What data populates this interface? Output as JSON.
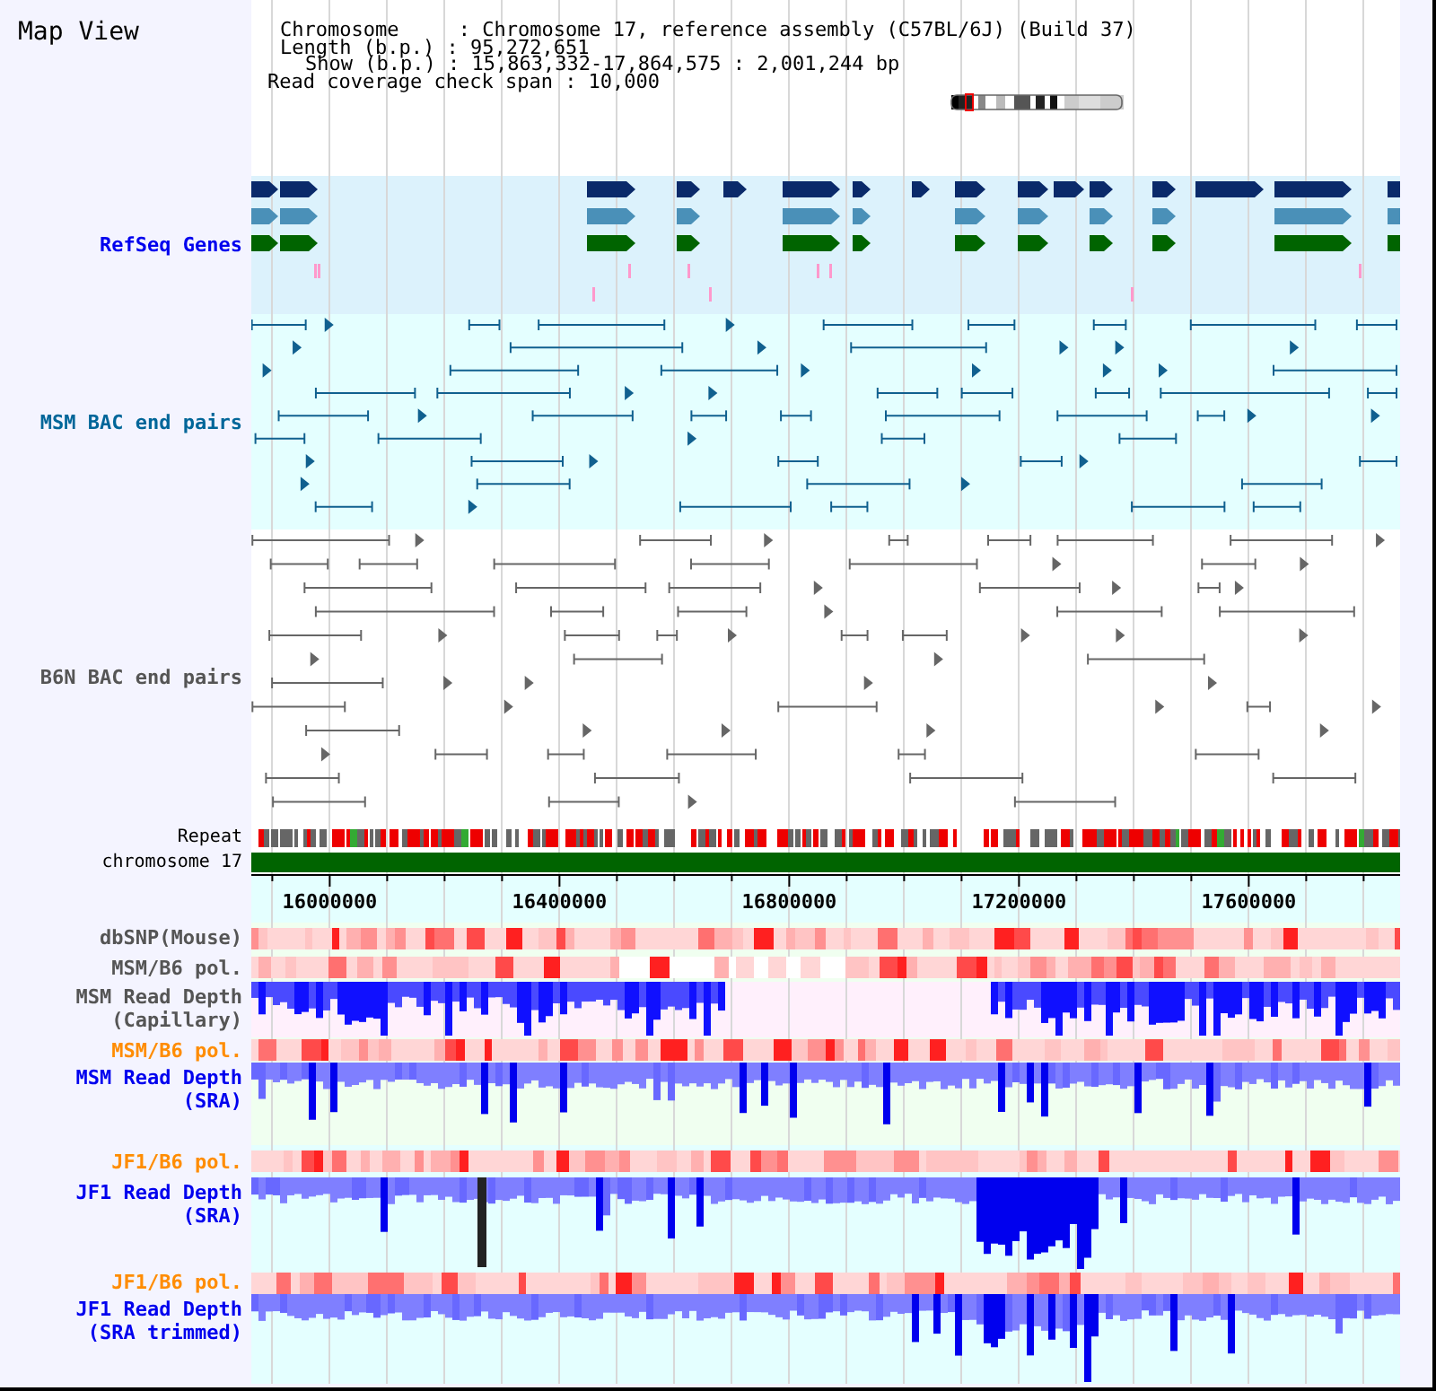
{
  "title": "Map View",
  "info_lines": [
    "Chromosome     : Chromosome 17, reference assembly (C57BL/6J) (Build 37)",
    "Length (b.p.) : 95,272,651",
    "Show (b.p.) : 15,863,332-17,864,575 : 2,001,244 bp",
    "Read coverage check span : 10,000"
  ],
  "tracks": [
    {
      "kind": "genes",
      "label": [
        "RefSeq Genes"
      ],
      "color": "#0000ee"
    },
    {
      "kind": "pairs",
      "label": [
        "MSM BAC end pairs"
      ],
      "color": "#006699"
    },
    {
      "kind": "pairs",
      "label": [
        "B6N BAC end pairs"
      ],
      "color": "#555555"
    },
    {
      "kind": "repeat",
      "label": [
        "Repeat"
      ],
      "color": "#000000"
    },
    {
      "kind": "chromosome",
      "label": [
        "chromosome 17"
      ],
      "color": "#000000"
    },
    {
      "kind": "axis",
      "ticks": [
        "16000000",
        "16400000",
        "16800000",
        "17200000",
        "17600000"
      ]
    },
    {
      "kind": "heat",
      "label": [
        "dbSNP(Mouse)"
      ],
      "color": "#555555"
    },
    {
      "kind": "heat",
      "label": [
        "MSM/B6 pol."
      ],
      "color": "#555555"
    },
    {
      "kind": "depth",
      "label": [
        "MSM Read Depth",
        "(Capillary)"
      ],
      "color": "#555555"
    },
    {
      "kind": "heat",
      "label": [
        "MSM/B6 pol."
      ],
      "color": "#ff8c00"
    },
    {
      "kind": "depth",
      "label": [
        "MSM Read Depth",
        "(SRA)"
      ],
      "color": "#0000ee"
    },
    {
      "kind": "heat",
      "label": [
        "JF1/B6 pol."
      ],
      "color": "#ff8c00"
    },
    {
      "kind": "depth",
      "label": [
        "JF1 Read Depth",
        "(SRA)"
      ],
      "color": "#0000ee"
    },
    {
      "kind": "heat",
      "label": [
        "JF1/B6 pol."
      ],
      "color": "#ff8c00"
    },
    {
      "kind": "depth",
      "label": [
        "JF1 Read Depth",
        "(SRA trimmed)"
      ],
      "color": "#0000ee"
    }
  ]
}
